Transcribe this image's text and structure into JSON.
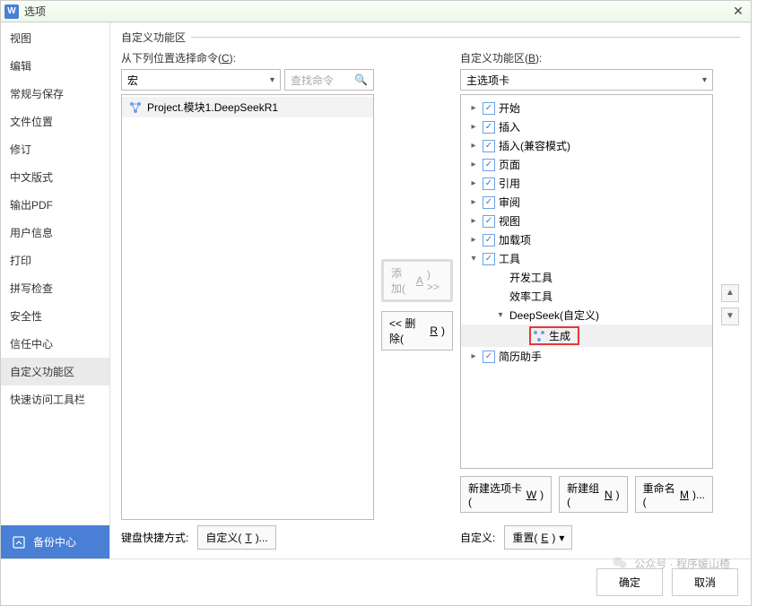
{
  "title": "选项",
  "app_icon_letter": "W",
  "sidebar": {
    "items": [
      "视图",
      "编辑",
      "常规与保存",
      "文件位置",
      "修订",
      "中文版式",
      "输出PDF",
      "用户信息",
      "打印",
      "拼写检查",
      "安全性",
      "信任中心",
      "自定义功能区",
      "快速访问工具栏"
    ],
    "selected_index": 12,
    "backup_label": "备份中心"
  },
  "main": {
    "section_label": "自定义功能区",
    "left_label": "从下列位置选择命令(C):",
    "left_select": "宏",
    "search_placeholder": "查找命令",
    "command_item": "Project.模块1.DeepSeekR1",
    "add_btn": "添加(A) >>",
    "remove_btn": "<< 删除(R)",
    "right_label": "自定义功能区(B):",
    "right_select": "主选项卡",
    "tree": [
      {
        "d": 0,
        "exp": "▸",
        "cb": true,
        "label": "开始"
      },
      {
        "d": 0,
        "exp": "▸",
        "cb": true,
        "label": "插入"
      },
      {
        "d": 0,
        "exp": "▸",
        "cb": true,
        "label": "插入(兼容模式)"
      },
      {
        "d": 0,
        "exp": "▸",
        "cb": true,
        "label": "页面"
      },
      {
        "d": 0,
        "exp": "▸",
        "cb": true,
        "label": "引用"
      },
      {
        "d": 0,
        "exp": "▸",
        "cb": true,
        "label": "审阅"
      },
      {
        "d": 0,
        "exp": "▸",
        "cb": true,
        "label": "视图"
      },
      {
        "d": 0,
        "exp": "▸",
        "cb": true,
        "label": "加载项"
      },
      {
        "d": 0,
        "exp": "▾",
        "cb": true,
        "label": "工具"
      },
      {
        "d": 1,
        "exp": "",
        "cb": null,
        "label": "开发工具"
      },
      {
        "d": 1,
        "exp": "",
        "cb": null,
        "label": "效率工具"
      },
      {
        "d": 1,
        "exp": "▾",
        "cb": null,
        "label": "DeepSeek(自定义)"
      },
      {
        "d": 2,
        "exp": "",
        "cb": null,
        "label": "生成",
        "gen": true
      },
      {
        "d": 0,
        "exp": "▸",
        "cb": true,
        "label": "简历助手"
      }
    ],
    "new_tab_btn": "新建选项卡(W)",
    "new_group_btn": "新建组(N)",
    "rename_btn": "重命名(M)...",
    "custom_label": "自定义:",
    "reset_btn": "重置(E)",
    "kb_label": "键盘快捷方式:",
    "kb_btn": "自定义(T)..."
  },
  "footer": {
    "ok": "确定",
    "cancel": "取消"
  },
  "watermark": "公众号 · 程序媛山楂"
}
